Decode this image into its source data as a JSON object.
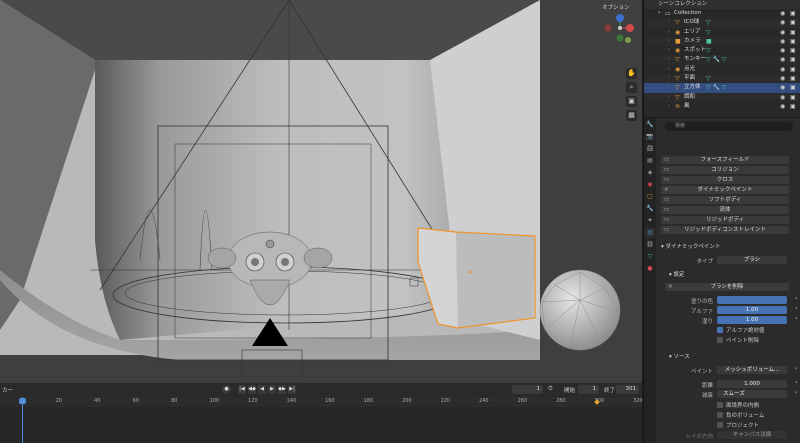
{
  "viewport": {
    "options_label": "オプション",
    "axes": {
      "x": "X",
      "y": "Y",
      "z": "Z"
    }
  },
  "outliner": {
    "header": "シーンコレクション",
    "rows": [
      {
        "name": "Collection",
        "icon": "collection-icon",
        "color": "#cccccc"
      },
      {
        "name": "ICO球",
        "icon": "mesh-icon",
        "color": "#e89a3c",
        "extra": "▽"
      },
      {
        "name": "エリア",
        "icon": "light-icon",
        "color": "#e89a3c",
        "extra": "▽"
      },
      {
        "name": "カメラ",
        "icon": "camera-icon",
        "color": "#e89a3c",
        "extra": "■"
      },
      {
        "name": "スポット",
        "icon": "light-icon",
        "color": "#e89a3c",
        "extra": "▽"
      },
      {
        "name": "モンキー",
        "icon": "mesh-icon",
        "color": "#e89a3c",
        "extra": "▽ 🔧 ▽"
      },
      {
        "name": "点光",
        "icon": "light-icon",
        "color": "#e89a3c",
        "extra": ""
      },
      {
        "name": "平面",
        "icon": "mesh-icon",
        "color": "#e89a3c",
        "extra": "▽"
      },
      {
        "name": "立方体",
        "icon": "mesh-icon",
        "color": "#e89a3c",
        "extra": "▽ 🔧 ▽",
        "selected": true
      },
      {
        "name": "調和",
        "icon": "mesh-icon",
        "color": "#e89a3c",
        "extra": ""
      },
      {
        "name": "風",
        "icon": "force-icon",
        "color": "#e89a3c",
        "extra": ""
      }
    ]
  },
  "properties": {
    "search_placeholder": "検索",
    "physics_buttons": [
      "フォースフィールド",
      "コリジョン",
      "クロス",
      "ダイナミックペイント",
      "ソフトボディ",
      "流体",
      "リジッドボディ",
      "リジッドボディコンストレイント"
    ],
    "dynamic_paint": {
      "header": "ダイナミックペイント",
      "type_label": "タイプ",
      "type_value": "ブラシ",
      "settings_header": "設定",
      "remove_brush": "ブラシを削除",
      "paint_color_label": "塗りの色",
      "alpha_label": "アルファ",
      "alpha_value": "1.00",
      "wetness_label": "湿り",
      "wetness_value": "1.00",
      "absolute_alpha": "アルファ絶対値",
      "erase_paint": "ペイント削除",
      "source_header": "ソース",
      "paint_label": "ペイント",
      "paint_value": "メッシュボリューム...",
      "distance_label": "距離",
      "distance_value": "1.000",
      "falloff_label": "減衰",
      "falloff_value": "スムーズ",
      "check_inner_proximity": "面境界の内側",
      "check_negate_volume": "負のボリューム",
      "check_project": "プロジェクト",
      "ray_direction_label": "レイの方向",
      "ray_direction_value": "キャンバス法線"
    }
  },
  "timeline": {
    "left_label": "カー",
    "current_frame": "1",
    "start_label": "開始",
    "start_value": "1",
    "end_label": "終了",
    "end_value": "301",
    "ruler": [
      "1",
      "20",
      "40",
      "60",
      "80",
      "100",
      "120",
      "140",
      "160",
      "180",
      "200",
      "220",
      "240",
      "260",
      "280",
      "300",
      "320"
    ]
  }
}
